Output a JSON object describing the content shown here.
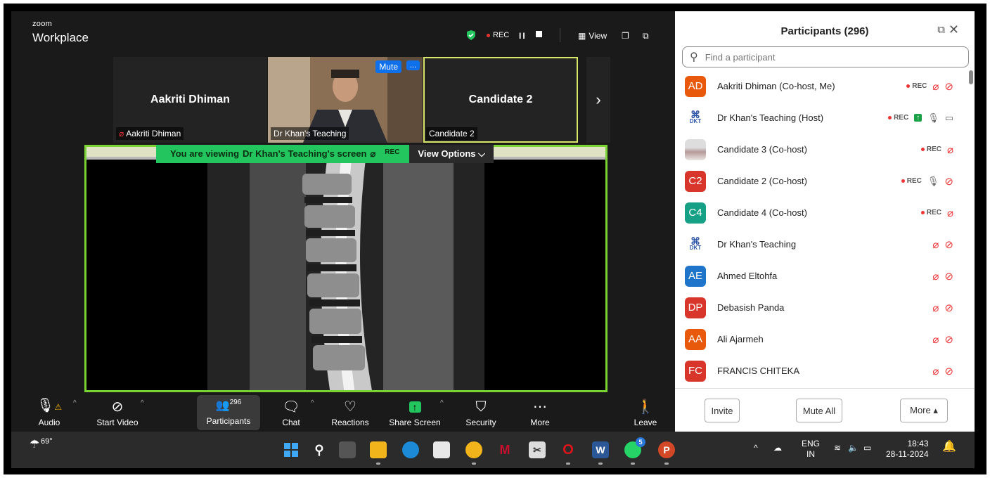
{
  "brand": {
    "small": "zoom",
    "big": "Workplace"
  },
  "topbar": {
    "rec_label": "REC",
    "pause_glyph": "II",
    "view_label": "View"
  },
  "thumbnails": [
    {
      "name_big": "Aakriti Dhiman",
      "tag": "Aakriti Dhiman",
      "muted": true
    },
    {
      "name_big": "",
      "tag": "Dr Khan's Teaching",
      "mute_btn": "Mute",
      "more_btn": "..."
    },
    {
      "name_big": "Candidate 2",
      "tag": "Candidate 2"
    }
  ],
  "next_glyph": "›",
  "share_banner": {
    "viewing_prefix": "You are viewing",
    "viewing_name": "Dr Khan's Teaching's screen",
    "rec": "REC",
    "view_options": "View Options ⌵"
  },
  "toolbar": {
    "audio": "Audio",
    "start_video": "Start Video",
    "participants": "Participants",
    "participants_count": "296",
    "chat": "Chat",
    "reactions": "Reactions",
    "share_screen": "Share Screen",
    "security": "Security",
    "more": "More",
    "leave": "Leave"
  },
  "panel": {
    "title": "Participants (296)",
    "search_placeholder": "Find a participant",
    "participants": [
      {
        "initials": "AD",
        "name": "Aakriti Dhiman (Co-host, Me)",
        "color": "#e8590c",
        "rec": "REC"
      },
      {
        "initials": "DKT",
        "name": "Dr Khan's Teaching (Host)",
        "logo": true,
        "rec": "REC"
      },
      {
        "initials": "",
        "name": "Candidate 3 (Co-host)",
        "img": true,
        "rec": "REC"
      },
      {
        "initials": "C2",
        "name": "Candidate 2 (Co-host)",
        "color": "#d9362b",
        "rec": "REC"
      },
      {
        "initials": "C4",
        "name": "Candidate 4 (Co-host)",
        "color": "#16a085",
        "rec": "REC"
      },
      {
        "initials": "DKT",
        "name": "Dr Khan's Teaching",
        "logo": true
      },
      {
        "initials": "AE",
        "name": "Ahmed Eltohfa",
        "color": "#1f75c9"
      },
      {
        "initials": "DP",
        "name": "Debasish Panda",
        "color": "#d9362b"
      },
      {
        "initials": "AA",
        "name": "Ali Ajarmeh",
        "color": "#e8590c"
      },
      {
        "initials": "FC",
        "name": "FRANCIS CHITEKA",
        "color": "#d9362b"
      }
    ],
    "invite": "Invite",
    "mute_all": "Mute All",
    "more": "More ▴"
  },
  "taskbar": {
    "temperature": "69°",
    "lang_top": "ENG",
    "lang_bottom": "IN",
    "time": "18:43",
    "date": "28-11-2024",
    "whatsapp_badge": "5"
  }
}
